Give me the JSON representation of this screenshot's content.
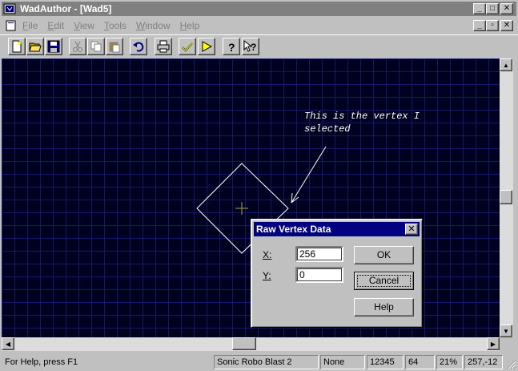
{
  "window": {
    "title": "WadAuthor - [Wad5]",
    "title_color": "#ffffff",
    "titlebar_color": "#808080"
  },
  "menu": {
    "items": [
      "File",
      "Edit",
      "View",
      "Tools",
      "Window",
      "Help"
    ]
  },
  "toolbar": {
    "buttons": [
      "new-icon",
      "open-icon",
      "save-icon",
      "cut-icon",
      "copy-icon",
      "paste-icon",
      "undo-icon",
      "print-icon",
      "check-icon",
      "run-icon",
      "help-icon",
      "context-help-icon"
    ]
  },
  "canvas": {
    "background": "#000020",
    "grid_color": "#0f1a66",
    "annotation_line1": "This is the vertex I",
    "annotation_line2": "selected"
  },
  "dialog": {
    "title": "Raw Vertex Data",
    "close_label": "✕",
    "x_label": "X:",
    "x_value": "256",
    "y_label": "Y:",
    "y_value": "0",
    "ok_label": "OK",
    "cancel_label": "Cancel",
    "help_label": "Help",
    "title_color": "#000080"
  },
  "statusbar": {
    "help_text": "For Help, press F1",
    "game": "Sonic Robo Blast 2",
    "mode": "None",
    "value1": "12345",
    "grid": "64",
    "zoom": "21%",
    "coords": "257,-12"
  }
}
